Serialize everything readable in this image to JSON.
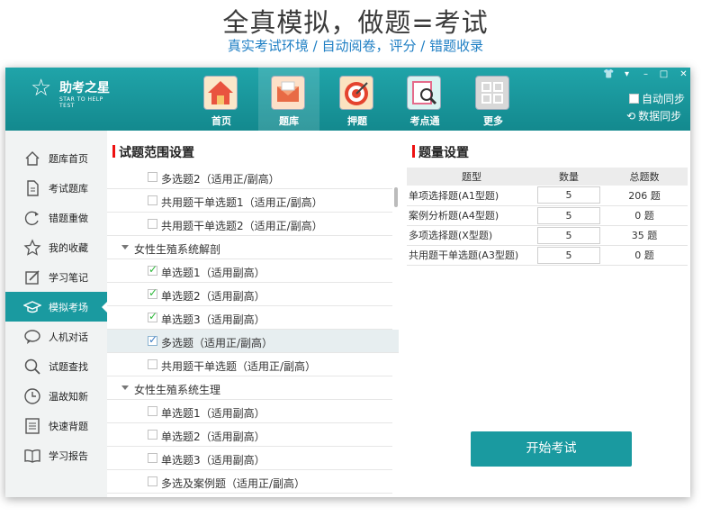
{
  "promo": {
    "title": "全真模拟，做题=考试",
    "subtitle": "真实考试环境 / 自动阅卷，评分 / 错题收录"
  },
  "app": {
    "logo_name": "助考之星",
    "logo_en": "STAR TO HELP TEST",
    "nav": [
      {
        "label": "首页",
        "icon": "home-icon"
      },
      {
        "label": "题库",
        "icon": "envelope-icon",
        "active": true
      },
      {
        "label": "押题",
        "icon": "target-icon"
      },
      {
        "label": "考点通",
        "icon": "magnifier-icon"
      },
      {
        "label": "更多",
        "icon": "grid-icon"
      }
    ],
    "window_controls": [
      "shirt-icon",
      "menu-icon",
      "minimize-icon",
      "maximize-icon",
      "close-icon"
    ],
    "auto_sync_label": "自动同步",
    "data_sync_label": "数据同步"
  },
  "sidebar": {
    "items": [
      {
        "label": "题库首页",
        "icon": "home-outline-icon"
      },
      {
        "label": "考试题库",
        "icon": "document-icon"
      },
      {
        "label": "错题重做",
        "icon": "redo-icon"
      },
      {
        "label": "我的收藏",
        "icon": "star-icon"
      },
      {
        "label": "学习笔记",
        "icon": "note-icon"
      },
      {
        "label": "模拟考场",
        "icon": "graduation-cap-icon",
        "active": true
      },
      {
        "label": "人机对话",
        "icon": "chat-icon"
      },
      {
        "label": "试题查找",
        "icon": "search-icon"
      },
      {
        "label": "温故知新",
        "icon": "clock-icon"
      },
      {
        "label": "快速背题",
        "icon": "list-icon"
      },
      {
        "label": "学习报告",
        "icon": "book-icon"
      }
    ]
  },
  "scope": {
    "title": "试题范围设置",
    "rows": [
      {
        "type": "item",
        "label": "多选题2（适用正/副高）",
        "checked": false
      },
      {
        "type": "item",
        "label": "共用题干单选题1（适用正/副高）",
        "checked": false
      },
      {
        "type": "item",
        "label": "共用题干单选题2（适用正/副高）",
        "checked": false
      },
      {
        "type": "category",
        "label": "女性生殖系统解剖"
      },
      {
        "type": "item",
        "label": "单选题1（适用副高）",
        "checked": true
      },
      {
        "type": "item",
        "label": "单选题2（适用副高）",
        "checked": true
      },
      {
        "type": "item",
        "label": "单选题3（适用副高）",
        "checked": true
      },
      {
        "type": "item",
        "label": "多选题（适用正/副高）",
        "checked": true,
        "highlight": true
      },
      {
        "type": "item",
        "label": "共用题干单选题（适用正/副高）",
        "checked": false
      },
      {
        "type": "category",
        "label": "女性生殖系统生理"
      },
      {
        "type": "item",
        "label": "单选题1（适用副高）",
        "checked": false
      },
      {
        "type": "item",
        "label": "单选题2（适用副高）",
        "checked": false
      },
      {
        "type": "item",
        "label": "单选题3（适用副高）",
        "checked": false
      },
      {
        "type": "item",
        "label": "多选及案例题（适用正/副高）",
        "checked": false
      }
    ]
  },
  "quantity": {
    "title": "题量设置",
    "headers": [
      "题型",
      "数量",
      "总题数"
    ],
    "rows": [
      {
        "type": "单项选择题(A1型题)",
        "count": "5",
        "total": "206 题"
      },
      {
        "type": "案例分析题(A4型题)",
        "count": "5",
        "total": "0 题"
      },
      {
        "type": "多项选择题(X型题)",
        "count": "5",
        "total": "35 题"
      },
      {
        "type": "共用题干单选题(A3型题)",
        "count": "5",
        "total": "0 题"
      }
    ]
  },
  "start_button": "开始考试",
  "colors": {
    "accent": "#1a9aa0",
    "promo_subtitle": "#1f7fc4",
    "section_bar": "#ee1111",
    "check_green": "#2fb83b"
  }
}
